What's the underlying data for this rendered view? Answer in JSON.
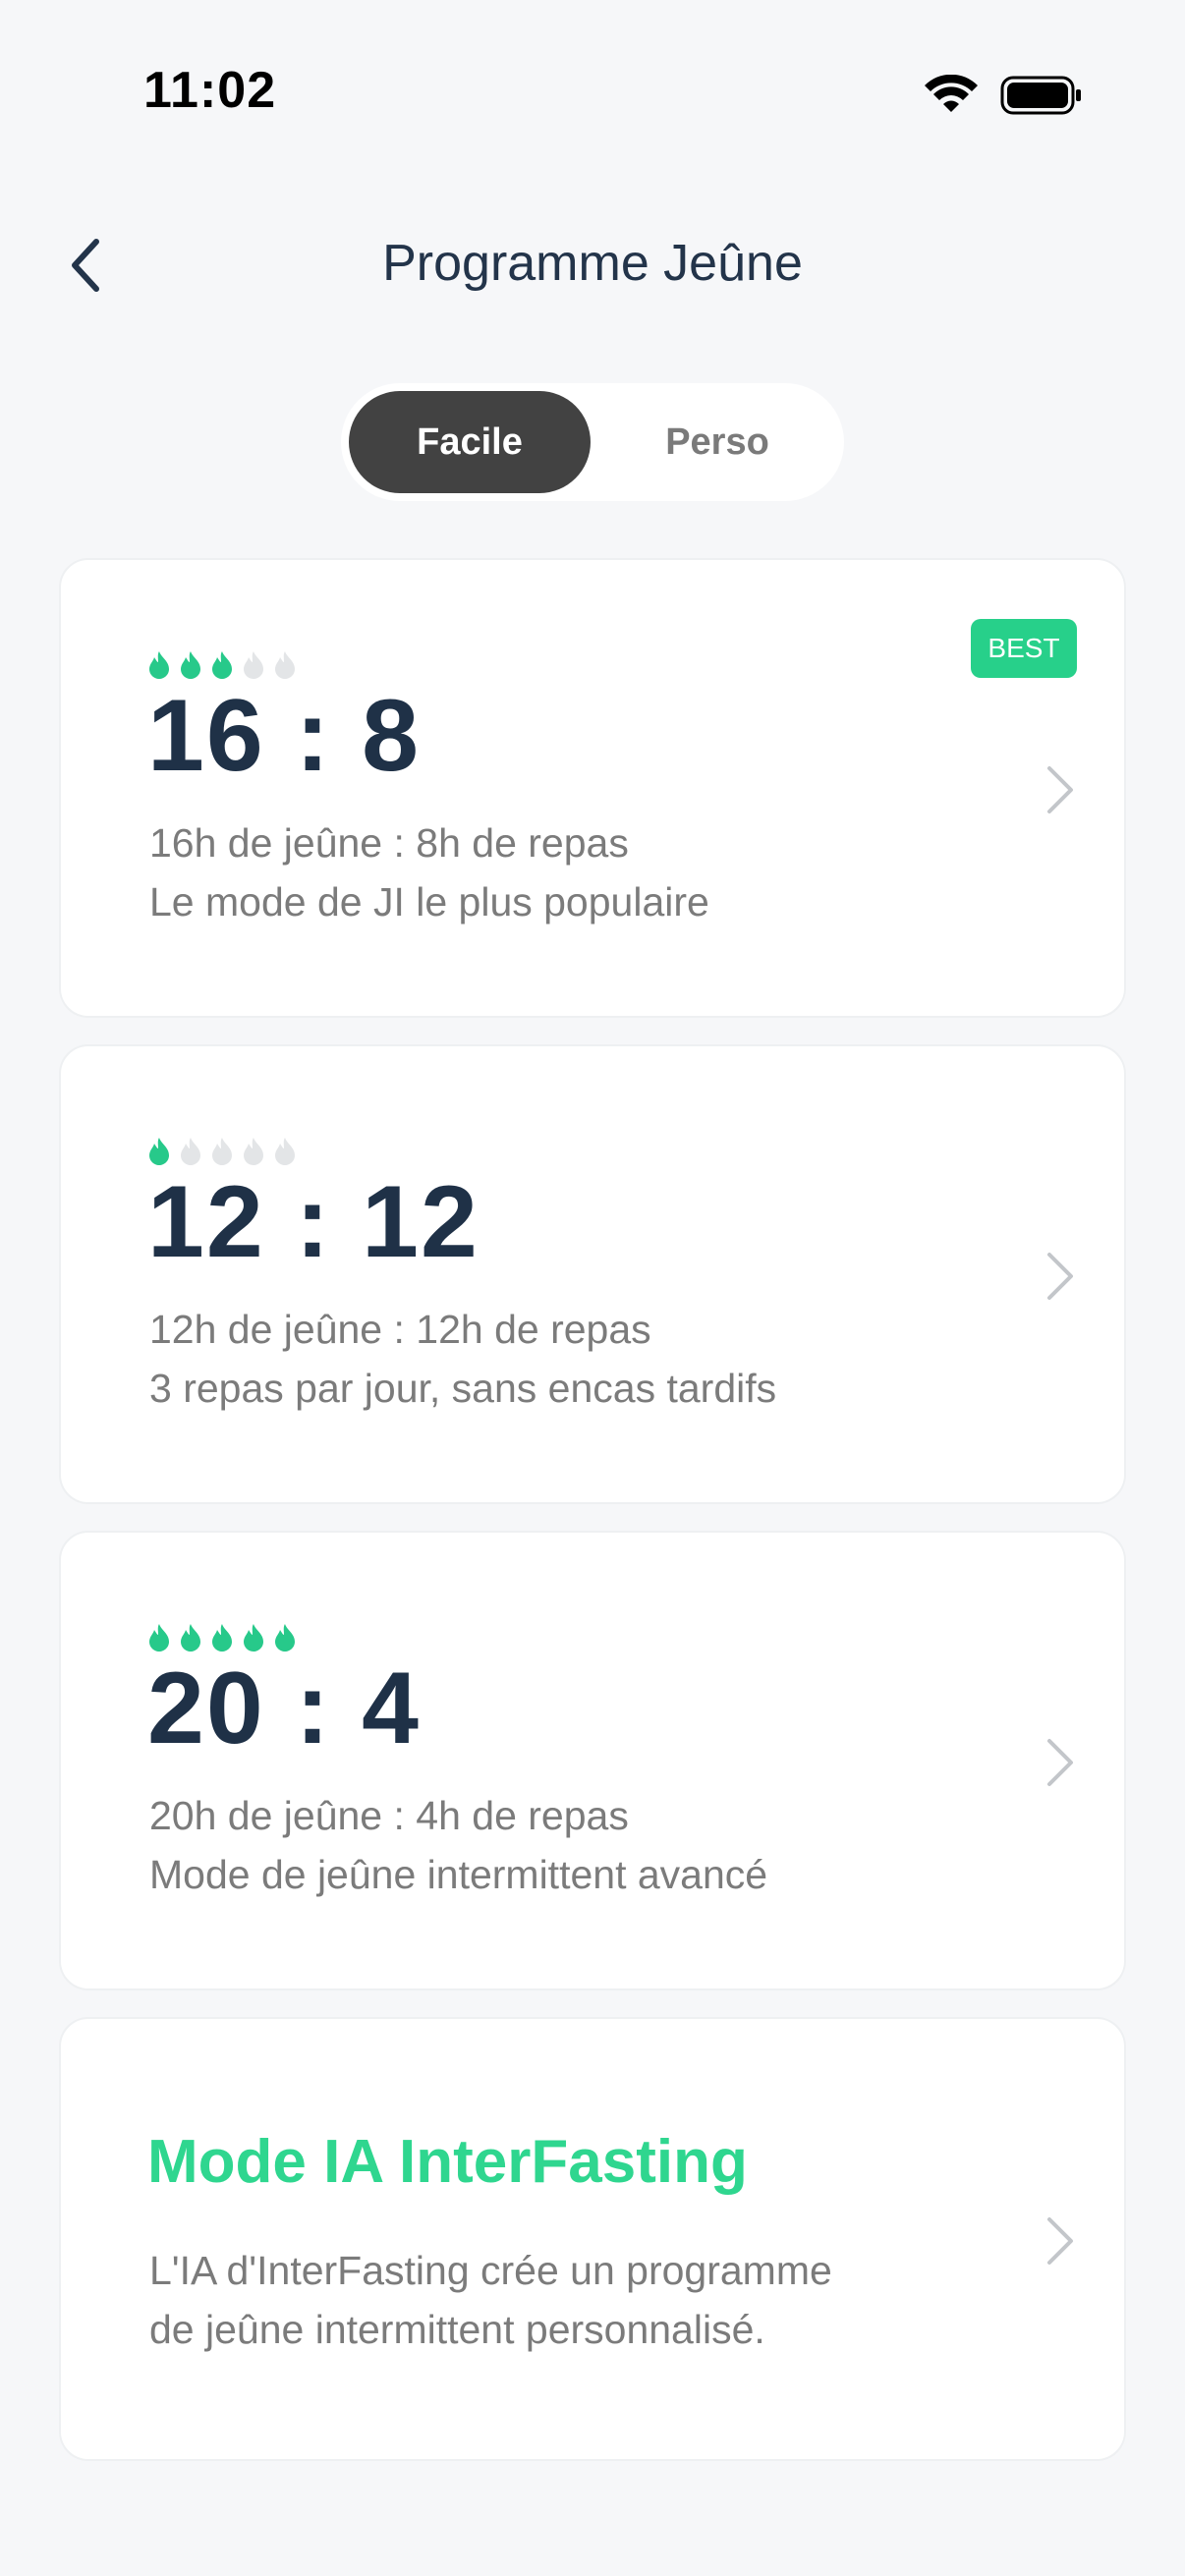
{
  "status": {
    "time": "11:02"
  },
  "header": {
    "title": "Programme Jeûne"
  },
  "tabs": {
    "active": "Facile",
    "inactive": "Perso"
  },
  "plans": [
    {
      "ratio": "16 : 8",
      "line1": "16h de jeûne : 8h de repas",
      "line2": "Le mode de JI le plus populaire",
      "difficulty": 3,
      "difficulty_max": 5,
      "badge": "BEST"
    },
    {
      "ratio": "12 : 12",
      "line1": "12h de jeûne : 12h de repas",
      "line2": "3 repas par jour, sans encas tardifs",
      "difficulty": 1,
      "difficulty_max": 5
    },
    {
      "ratio": "20 : 4",
      "line1": "20h de jeûne : 4h de repas",
      "line2": "Mode de jeûne intermittent avancé",
      "difficulty": 5,
      "difficulty_max": 5
    }
  ],
  "ai_mode": {
    "title": "Mode IA InterFasting",
    "line1": "L'IA d'InterFasting crée un programme",
    "line2": "de jeûne intermittent personnalisé."
  },
  "colors": {
    "accent": "#2fd68f",
    "flame_on": "#27c98a",
    "flame_off": "#e3e5e7",
    "heading": "#1f3147",
    "tab_active": "#424242"
  }
}
